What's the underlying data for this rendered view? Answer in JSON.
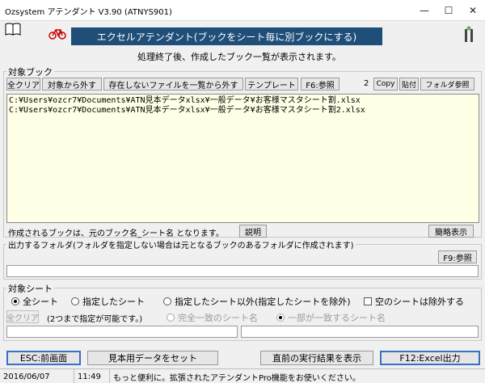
{
  "window": {
    "title": "Ozsystem アテンダント V3.90 (ATNYS901)",
    "min_glyph": "—",
    "max_glyph": "☐",
    "close_glyph": "✕"
  },
  "banner": {
    "title": "エクセルアテンダント(ブックをシート毎に別ブックにする)",
    "subtitle": "処理終了後、作成したブック一覧が表示されます。"
  },
  "target_book": {
    "label": "対象ブック",
    "buttons": {
      "clear_all": "全クリア",
      "remove": "対象から外す",
      "remove_missing": "存在しないファイルを一覧から外す",
      "template": "テンプレート",
      "f6_ref": "F6:参照",
      "copy": "Copy",
      "paste": "貼付",
      "folder_ref": "フォルダ参照"
    },
    "count": "2",
    "files": [
      "C:¥Users¥ozcr7¥Documents¥ATN見本データxlsx¥一般データ¥お客様マスタシート割.xlsx",
      "C:¥Users¥ozcr7¥Documents¥ATN見本データxlsx¥一般データ¥お客様マスタシート割2.xlsx"
    ],
    "note": "作成されるブックは、元のブック名_シート名 となります。",
    "explain": "説明",
    "simple_view": "簡略表示"
  },
  "output_folder": {
    "label": "出力するフォルダ(フォルダを指定しない場合は元となるブックのあるフォルダに作成されます)",
    "f9_ref": "F9:参照",
    "value": ""
  },
  "target_sheet": {
    "label": "対象シート",
    "radios": {
      "all": "全シート",
      "specified": "指定したシート",
      "except": "指定したシート以外(指定したシートを除外)"
    },
    "selected": "all",
    "exclude_empty": "空のシートは除外する",
    "clear_all": "全クリア",
    "hint": "(2つまで指定が可能です。)",
    "exact_match": "完全一致のシート名",
    "partial_match": "一部が一致するシート名",
    "field1": "",
    "field2": ""
  },
  "footer_buttons": {
    "esc": "ESC:前画面",
    "sample": "見本用データをセット",
    "last_result": "直前の実行結果を表示",
    "f12": "F12:Excel出力"
  },
  "status": {
    "date": "2016/06/07",
    "time": "11:49",
    "message": "もっと便利に。拡張されたアテンダントPro機能をお使いください。"
  }
}
